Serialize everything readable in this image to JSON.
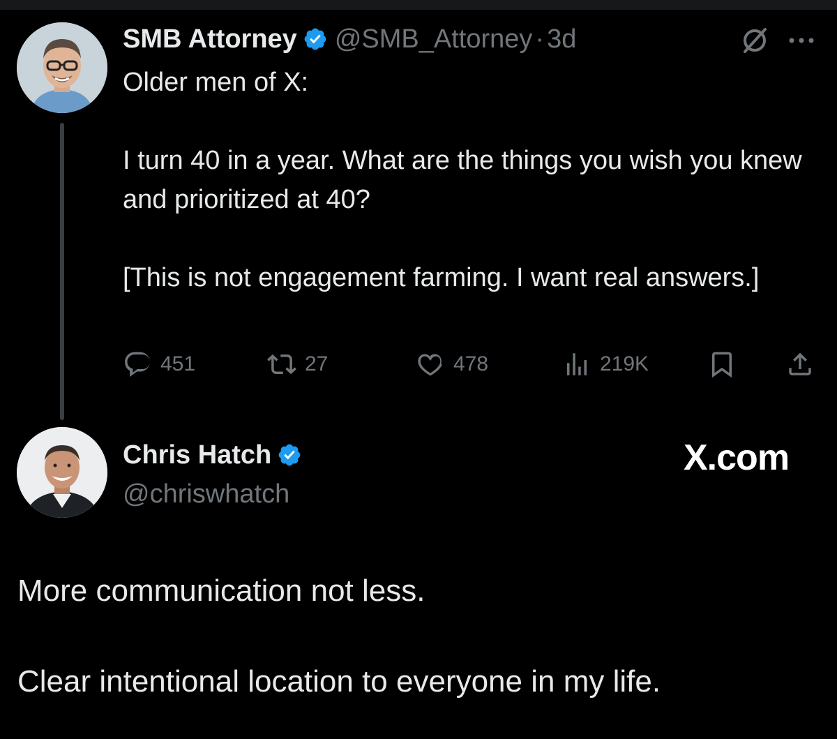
{
  "tweet": {
    "author_name": "SMB Attorney",
    "handle": "@SMB_Attorney",
    "separator": "·",
    "time": "3d",
    "text_line1": "Older men of X:",
    "text_line2": "I turn 40 in a year. What are the things you wish you knew and prioritized at 40?",
    "text_line3": "[This is not engagement farming. I want real answers.]",
    "stats": {
      "replies": "451",
      "retweets": "27",
      "likes": "478",
      "views": "219K"
    }
  },
  "reply": {
    "author_name": "Chris Hatch",
    "handle": "@chriswhatch",
    "brand": "X.com",
    "line1": "More communication not less.",
    "line2": "Clear intentional location to everyone in my life."
  },
  "colors": {
    "background": "#000000",
    "text": "#e7e9ea",
    "muted": "#71767b",
    "verified": "#1d9bf0"
  },
  "icons": [
    "verified-badge-icon",
    "hide-icon",
    "more-icon",
    "reply-icon",
    "retweet-icon",
    "like-icon",
    "views-icon",
    "bookmark-icon",
    "share-icon"
  ]
}
